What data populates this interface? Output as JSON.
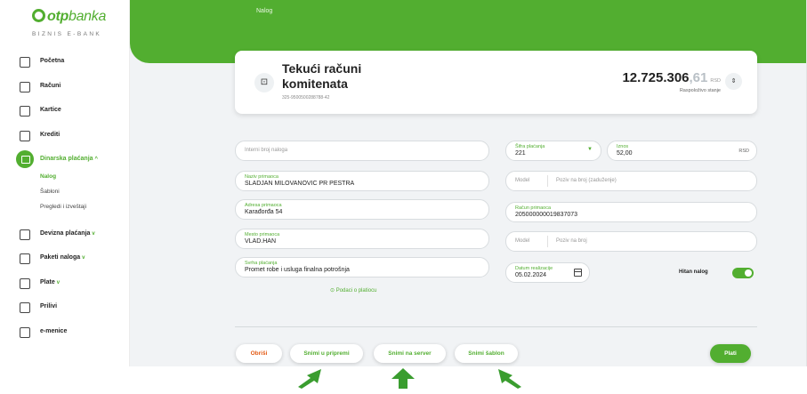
{
  "brand": {
    "name_bold": "otp",
    "name_rest": "banka",
    "subtitle": "BIZNIS E-BANK"
  },
  "header": {
    "title": "Nalog"
  },
  "sidebar": {
    "items": [
      {
        "label": "Početna",
        "icon": "home-icon"
      },
      {
        "label": "Računi",
        "icon": "accounts-icon"
      },
      {
        "label": "Kartice",
        "icon": "card-icon"
      },
      {
        "label": "Krediti",
        "icon": "credit-icon"
      },
      {
        "label": "Dinarska plaćanja",
        "icon": "payment-icon",
        "chevron": "^"
      },
      {
        "label": "Devizna plaćanja",
        "icon": "currency-icon",
        "chevron": "v"
      },
      {
        "label": "Paketi naloga",
        "icon": "package-icon",
        "chevron": "v"
      },
      {
        "label": "Plate",
        "icon": "salary-icon",
        "chevron": "v"
      },
      {
        "label": "Prilivi",
        "icon": "inflow-icon"
      },
      {
        "label": "e-menice",
        "icon": "note-icon"
      }
    ],
    "subitems": [
      {
        "label": "Nalog"
      },
      {
        "label": "Šabloni"
      },
      {
        "label": "Pregledi i izveštaji"
      }
    ]
  },
  "account": {
    "name": "Tekući računi komitenata",
    "number": "325-9500500288788-42",
    "balance_int": "12.725.306",
    "balance_dec": ",61",
    "currency": "RSD",
    "balance_label": "Raspoloživo stanje"
  },
  "form": {
    "internal_ref_placeholder": "Interni broj naloga",
    "recipient_name_label": "Naziv primaoca",
    "recipient_name": "SLADJAN MILOVANOVIC PR PESTRA",
    "recipient_address_label": "Adresa primaoca",
    "recipient_address": "Karađorđa 54",
    "recipient_city_label": "Mesto primaoca",
    "recipient_city": "VLAD.HAN",
    "purpose_label": "Svrha plaćanja",
    "purpose": "Promet robe i usluga finalna potrošnja",
    "payer_link": "Podaci o platiocu",
    "payment_code_label": "Šifra plaćanja",
    "payment_code": "221",
    "amount_label": "Iznos",
    "amount": "52,00",
    "amount_currency": "RSD",
    "model_placeholder": "Model",
    "debit_ref_placeholder": "Poziv na broj (zaduženje)",
    "recipient_account_label": "Račun primaoca",
    "recipient_account": "205000000019837073",
    "model2_placeholder": "Model",
    "credit_ref_placeholder": "Poziv na broj",
    "date_label": "Datum realizacije",
    "date": "05.02.2024",
    "urgent_label": "Hitan nalog",
    "urgent_on": true
  },
  "actions": {
    "delete": "Obriši",
    "save_prep": "Snimi u pripremi",
    "save_server": "Snimi na server",
    "save_template": "Snimi šablon",
    "pay": "Plati"
  },
  "colors": {
    "accent": "#52ae30",
    "danger": "#e35a14"
  }
}
